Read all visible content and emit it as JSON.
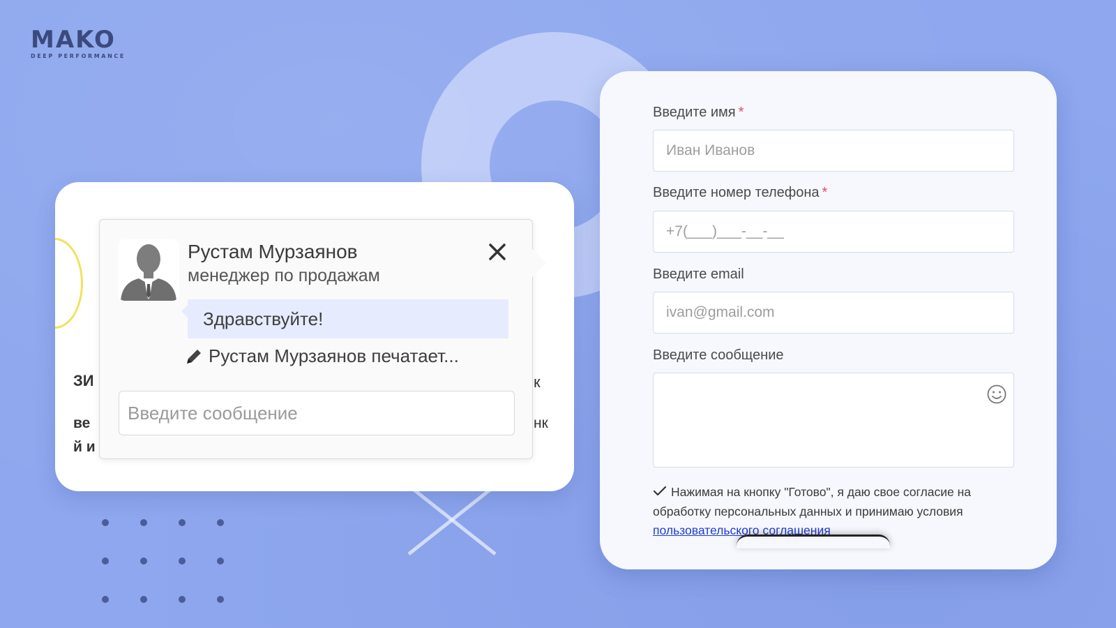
{
  "brand": {
    "logo_text": "MAKO",
    "logo_tagline": "DEEP PERFORMANCE"
  },
  "colors": {
    "background": "#8ea7ee",
    "accent_bubble": "#e6ecfd",
    "required_mark": "#e6486a",
    "link": "#1f3cd6",
    "logo": "#3b4a7d"
  },
  "chat": {
    "manager_name": "Рустам Мурзаянов",
    "manager_role": "менеджер по продажам",
    "greeting": "Здравствуйте!",
    "typing_status": "Рустам Мурзаянов печатает...",
    "input_placeholder": "Введите сообщение",
    "icons": {
      "avatar": "user-silhouette-icon",
      "close": "close-icon",
      "typing": "pencil-icon"
    }
  },
  "form": {
    "name": {
      "label": "Введите имя",
      "required_mark": "*",
      "placeholder": "Иван Иванов"
    },
    "phone": {
      "label": "Введите номер телефона",
      "required_mark": "*",
      "placeholder": "+7(___)___-__-__"
    },
    "email": {
      "label": "Введите email",
      "placeholder": "ivan@gmail.com"
    },
    "message": {
      "label": "Введите сообщение",
      "emoji_icon": "smiley-icon"
    },
    "consent_text": "Нажимая на кнопку \"Готово\", я даю свое согласие на обработку персональных данных и принимаю условия",
    "consent_link": "пользовательского соглашения",
    "consent_checked": true
  },
  "background_fragments": {
    "left_top": "ЗИ",
    "left_mid": "ве",
    "left_bot": "й и",
    "right_top": "к",
    "right_mid": "нк"
  }
}
